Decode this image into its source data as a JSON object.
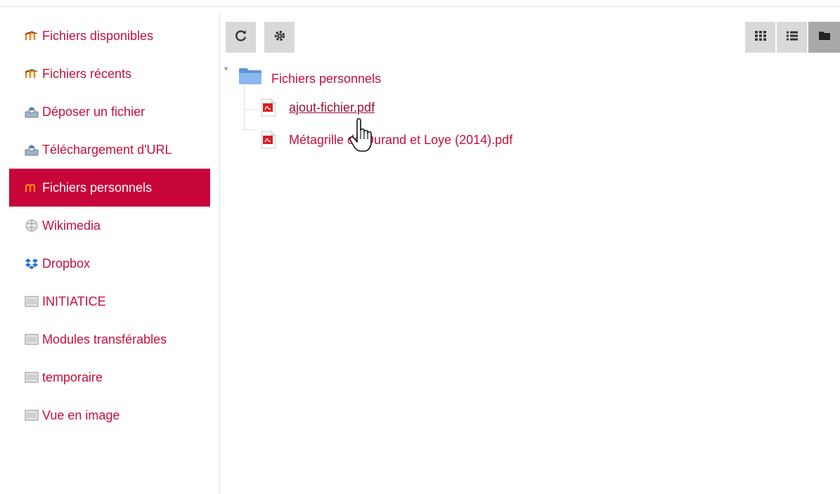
{
  "sidebar": {
    "items": [
      {
        "label": "Fichiers disponibles",
        "icon": "moodle-logo-icon",
        "active": false
      },
      {
        "label": "Fichiers récents",
        "icon": "moodle-logo-icon",
        "active": false
      },
      {
        "label": "Déposer un fichier",
        "icon": "upload-icon",
        "active": false
      },
      {
        "label": "Téléchargement d'URL",
        "icon": "url-download-icon",
        "active": false
      },
      {
        "label": "Fichiers personnels",
        "icon": "moodle-logo-icon",
        "active": true
      },
      {
        "label": "Wikimedia",
        "icon": "wikimedia-globe-icon",
        "active": false
      },
      {
        "label": "Dropbox",
        "icon": "dropbox-icon",
        "active": false
      },
      {
        "label": "INITIATICE",
        "icon": "repository-icon",
        "active": false
      },
      {
        "label": "Modules transférables",
        "icon": "repository-icon",
        "active": false
      },
      {
        "label": "temporaire",
        "icon": "repository-icon",
        "active": false
      },
      {
        "label": "Vue en image",
        "icon": "repository-icon",
        "active": false
      }
    ]
  },
  "toolbar": {
    "left_buttons": [
      {
        "icon": "refresh-icon"
      },
      {
        "icon": "gear-icon"
      }
    ],
    "view_buttons": [
      {
        "icon": "grid-view-icon"
      },
      {
        "icon": "list-view-icon"
      },
      {
        "icon": "folder-view-icon",
        "active": true
      }
    ]
  },
  "tree": {
    "root": {
      "label": "Fichiers personnels",
      "icon": "folder-icon",
      "expanded": true,
      "toggle": "▼"
    },
    "files": [
      {
        "label": "ajout-fichier.pdf",
        "icon": "pdf-icon",
        "hovered": true
      },
      {
        "label": "Métagrille de Durand et Loye (2014).pdf",
        "icon": "pdf-icon",
        "hovered": false
      }
    ]
  },
  "colors": {
    "accent": "#c8053a",
    "link": "#c40f3a",
    "toolbar_button": "#d9d9d9",
    "toolbar_button_active": "#a9a9a9",
    "folder": "#6fa7e6"
  }
}
